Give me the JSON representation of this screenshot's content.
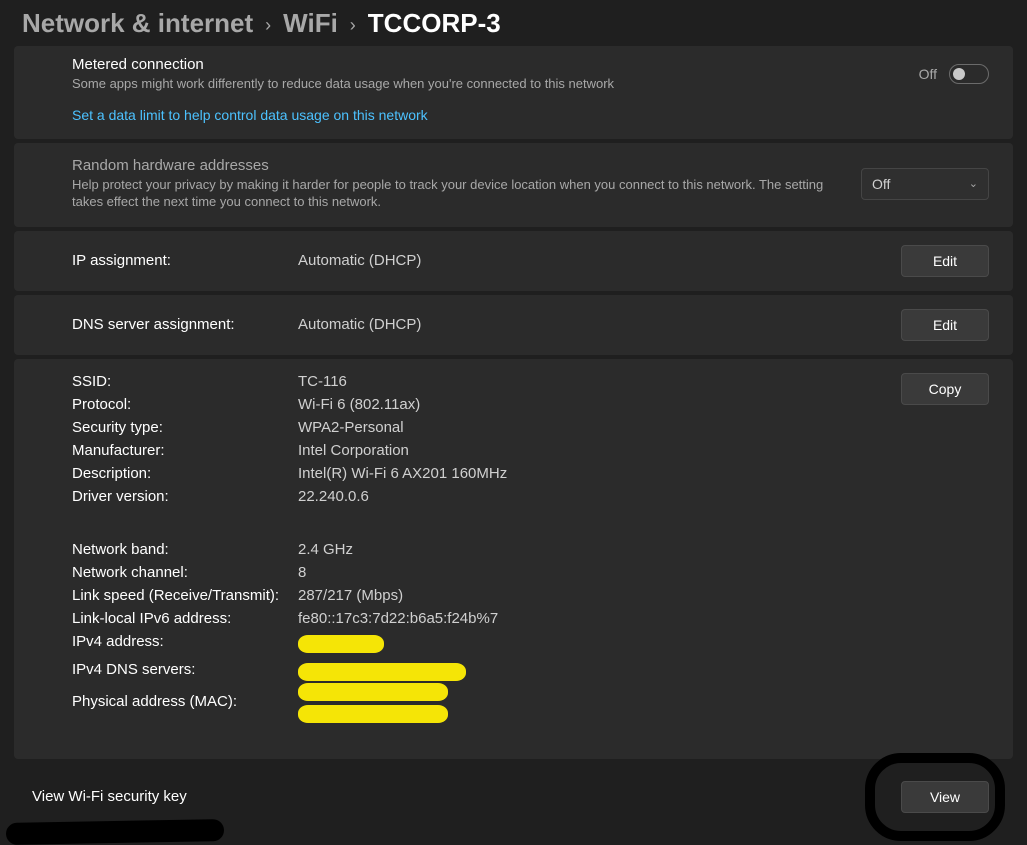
{
  "breadcrumb": {
    "root": "Network & internet",
    "mid": "WiFi",
    "current": "TCCORP-3"
  },
  "metered": {
    "title": "Metered connection",
    "desc": "Some apps might work differently to reduce data usage when you're connected to this network",
    "link": "Set a data limit to help control data usage on this network",
    "toggle_label": "Off"
  },
  "random_hw": {
    "title": "Random hardware addresses",
    "desc": "Help protect your privacy by making it harder for people to track your device location when you connect to this network. The setting takes effect the next time you connect to this network.",
    "dropdown_value": "Off"
  },
  "ip_assignment": {
    "label": "IP assignment:",
    "value": "Automatic (DHCP)",
    "edit": "Edit"
  },
  "dns_assignment": {
    "label": "DNS server assignment:",
    "value": "Automatic (DHCP)",
    "edit": "Edit"
  },
  "details": {
    "copy": "Copy",
    "rows1": [
      {
        "label": "SSID:",
        "value": "TC-116"
      },
      {
        "label": "Protocol:",
        "value": "Wi-Fi 6 (802.11ax)"
      },
      {
        "label": "Security type:",
        "value": "WPA2-Personal"
      },
      {
        "label": "Manufacturer:",
        "value": "Intel Corporation"
      },
      {
        "label": "Description:",
        "value": "Intel(R) Wi-Fi 6 AX201 160MHz"
      },
      {
        "label": "Driver version:",
        "value": "22.240.0.6"
      }
    ],
    "rows2": [
      {
        "label": "Network band:",
        "value": "2.4 GHz"
      },
      {
        "label": "Network channel:",
        "value": "8"
      },
      {
        "label": "Link speed (Receive/Transmit):",
        "value": "287/217 (Mbps)"
      },
      {
        "label": "Link-local IPv6 address:",
        "value": "fe80::17c3:7d22:b6a5:f24b%7"
      },
      {
        "label": "IPv4 address:",
        "value": ""
      },
      {
        "label": "IPv4 DNS servers:",
        "value": ""
      },
      {
        "label": "Physical address (MAC):",
        "value": ""
      }
    ]
  },
  "security_key": {
    "label": "View Wi-Fi security key",
    "button": "View"
  }
}
